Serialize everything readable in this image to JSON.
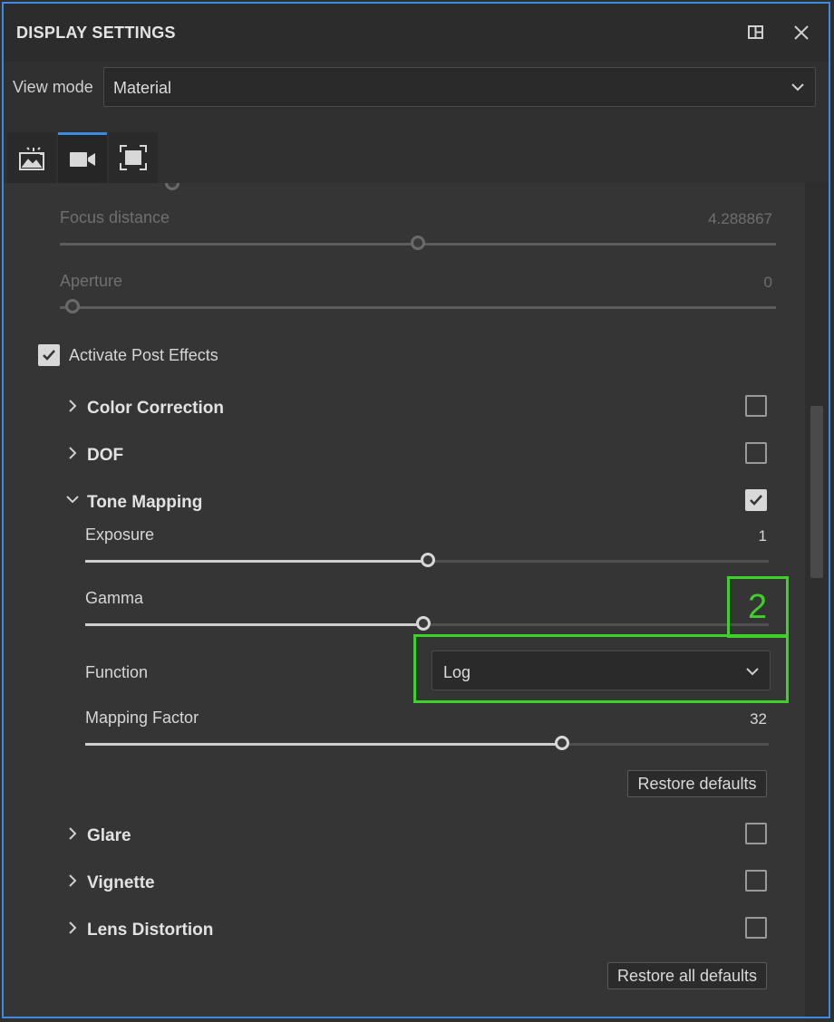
{
  "window": {
    "title": "DISPLAY SETTINGS"
  },
  "view_mode": {
    "label": "View mode",
    "value": "Material"
  },
  "tabs": [
    {
      "name": "environment-tab",
      "icon": "image-sparkle-icon",
      "active": false
    },
    {
      "name": "camera-tab",
      "icon": "video-camera-icon",
      "active": true
    },
    {
      "name": "frame-tab",
      "icon": "frame-icon",
      "active": false
    }
  ],
  "camera": {
    "focus_distance": {
      "label": "Focus distance",
      "value": "4.288867",
      "level": 0.5
    },
    "aperture": {
      "label": "Aperture",
      "value": "0",
      "level": 0.0
    }
  },
  "post_effects": {
    "label": "Activate Post Effects",
    "checked": true
  },
  "sections": {
    "color_correction": {
      "label": "Color Correction",
      "enabled": false,
      "expanded": false
    },
    "dof": {
      "label": "DOF",
      "enabled": false,
      "expanded": false
    },
    "tone_mapping": {
      "label": "Tone Mapping",
      "enabled": true,
      "expanded": true
    },
    "glare": {
      "label": "Glare",
      "enabled": false,
      "expanded": false
    },
    "vignette": {
      "label": "Vignette",
      "enabled": false,
      "expanded": false
    },
    "lens_distortion": {
      "label": "Lens Distortion",
      "enabled": false,
      "expanded": false
    }
  },
  "tone_mapping": {
    "exposure": {
      "label": "Exposure",
      "value": "1",
      "level": 0.5
    },
    "gamma": {
      "label": "Gamma",
      "level": 0.5
    },
    "function": {
      "label": "Function",
      "value": "Log"
    },
    "mapping_factor": {
      "label": "Mapping Factor",
      "value": "32",
      "level": 0.7
    },
    "restore_label": "Restore defaults"
  },
  "restore_all_label": "Restore all defaults",
  "annotation": {
    "number": "2",
    "color": "#3ed12a"
  },
  "colors": {
    "accent": "#3b8ce0",
    "panel": "#353535"
  }
}
